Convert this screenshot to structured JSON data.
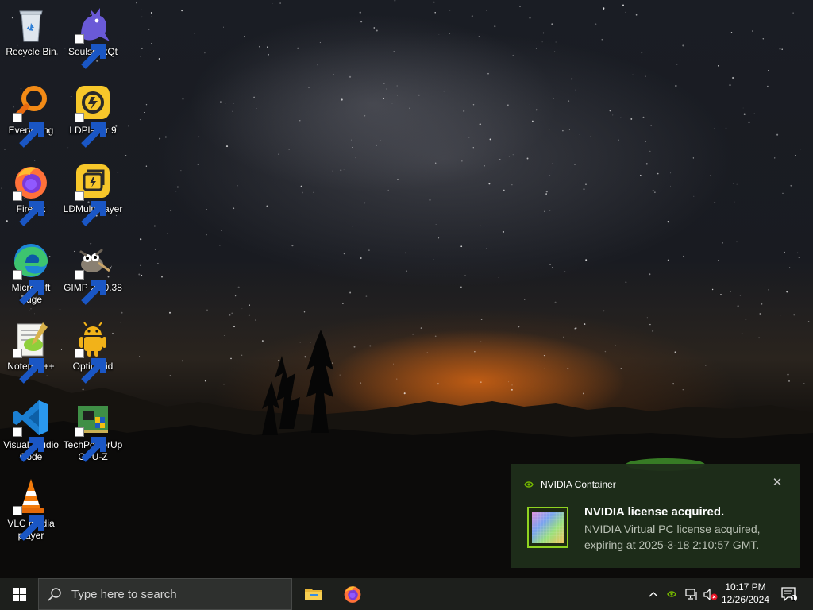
{
  "desktop": {
    "icons": [
      {
        "label": "Recycle Bin",
        "icon": "recycle-bin-icon"
      },
      {
        "label": "SoulseekQt",
        "icon": "soulseek-bird-icon"
      },
      {
        "label": "Everything",
        "icon": "magnifier-ring-icon"
      },
      {
        "label": "LDPlayer 9",
        "icon": "ldplayer-icon"
      },
      {
        "label": "Firefox",
        "icon": "firefox-icon"
      },
      {
        "label": "LDMultiPlayer",
        "icon": "ldmultiplayer-icon"
      },
      {
        "label": "Microsoft Edge",
        "icon": "edge-icon"
      },
      {
        "label": "GIMP 2.10.38",
        "icon": "gimp-icon"
      },
      {
        "label": "Notepad++",
        "icon": "notepadpp-icon"
      },
      {
        "label": "OptiDroid",
        "icon": "android-icon"
      },
      {
        "label": "Visual Studio Code",
        "icon": "vscode-icon"
      },
      {
        "label": "TechPowerUp GPU-Z",
        "icon": "gpuz-icon"
      },
      {
        "label": "VLC media player",
        "icon": "vlc-cone-icon"
      }
    ]
  },
  "notification": {
    "app_name": "NVIDIA Container",
    "title": "NVIDIA license acquired.",
    "body": "NVIDIA Virtual PC license acquired, expiring at 2025-3-18 2:10:57 GMT.",
    "close_glyph": "✕",
    "accent": "#76b900"
  },
  "taskbar": {
    "search_placeholder": "Type here to search",
    "pinned": [
      "file-explorer-icon",
      "firefox-icon"
    ],
    "tray": {
      "time": "10:17 PM",
      "date": "12/26/2024",
      "notification_count": "1"
    }
  },
  "colors": {
    "taskbar_bg": "#1d1f1c",
    "toast_bg": "#1f2e1a"
  }
}
